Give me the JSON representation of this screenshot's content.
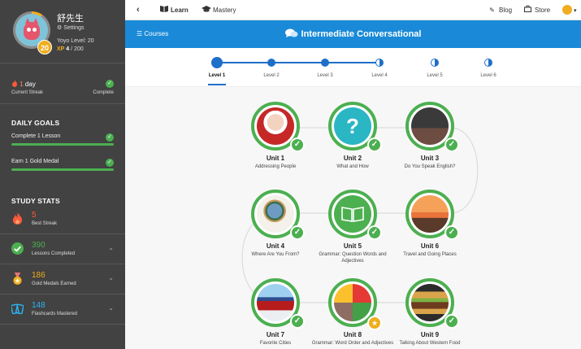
{
  "profile": {
    "username": "舒先生",
    "settings_label": "Settings",
    "yoyo_level": "Yoyo Level: 20",
    "level_badge": "20",
    "xp_label": "XP",
    "xp_current": "4",
    "xp_total": "/ 200"
  },
  "streak": {
    "value": "1",
    "unit": "day",
    "label": "Current Streak",
    "status": "Complete"
  },
  "daily_goals": {
    "title": "DAILY GOALS",
    "items": [
      {
        "label": "Complete 1 Lesson"
      },
      {
        "label": "Earn 1 Gold Medal"
      }
    ]
  },
  "study_stats": {
    "title": "STUDY STATS",
    "items": [
      {
        "value": "5",
        "label": "Best Streak",
        "color": "#ff5a3c",
        "icon": "flame-icon"
      },
      {
        "value": "390",
        "label": "Lessons Completed",
        "color": "#4caf50",
        "icon": "check-circle-icon"
      },
      {
        "value": "186",
        "label": "Gold Medals Earned",
        "color": "#f0ad1e",
        "icon": "medal-icon"
      },
      {
        "value": "148",
        "label": "Flashcards Mastered",
        "color": "#29b6f6",
        "icon": "flashcards-icon"
      }
    ]
  },
  "topnav": {
    "back_icon": "chevron-left-icon",
    "learn": "Learn",
    "mastery": "Mastery",
    "blog": "Blog",
    "store": "Store"
  },
  "banner": {
    "courses": "Courses",
    "title": "Intermediate Conversational"
  },
  "levels": [
    {
      "label": "Level 1",
      "state": "complete",
      "active": true
    },
    {
      "label": "Level 2",
      "state": "complete"
    },
    {
      "label": "Level 3",
      "state": "complete"
    },
    {
      "label": "Level 4",
      "state": "partial"
    },
    {
      "label": "Level 5",
      "state": "partial"
    },
    {
      "label": "Level 6",
      "state": "partial"
    }
  ],
  "units": [
    {
      "name": "Unit 1",
      "desc": "Addressing People",
      "badge": "check"
    },
    {
      "name": "Unit 2",
      "desc": "What and How",
      "badge": "check"
    },
    {
      "name": "Unit 3",
      "desc": "Do You Speak English?",
      "badge": "check"
    },
    {
      "name": "Unit 4",
      "desc": "Where Are You From?",
      "badge": "check"
    },
    {
      "name": "Unit 5",
      "desc": "Grammar: Question Words and Adjectives",
      "badge": "check"
    },
    {
      "name": "Unit 6",
      "desc": "Travel and Going Places",
      "badge": "check"
    },
    {
      "name": "Unit 7",
      "desc": "Favorite Cities",
      "badge": "check"
    },
    {
      "name": "Unit 8",
      "desc": "Grammar: Word Order and Adjectives",
      "badge": "medal"
    },
    {
      "name": "Unit 9",
      "desc": "Talking About Western Food",
      "badge": "check"
    }
  ],
  "colors": {
    "accent_blue": "#1a8ad8",
    "success_green": "#4caf50",
    "gold": "#f0ad1e",
    "sidebar_bg": "#424242"
  }
}
